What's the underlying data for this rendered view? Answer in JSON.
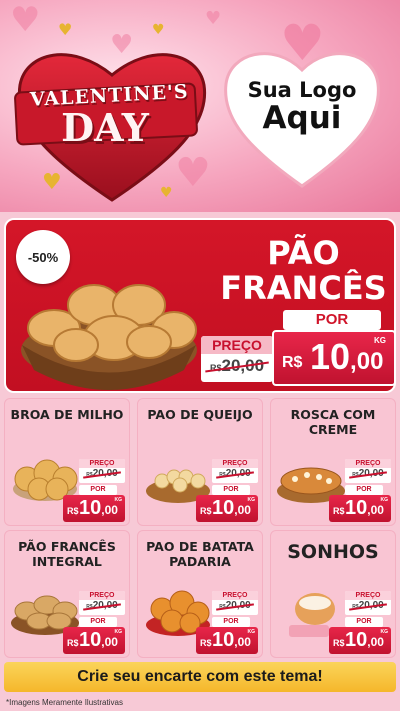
{
  "header": {
    "badge_line1": "VALENTINE'S",
    "badge_line2": "DAY",
    "logo_line1": "Sua Logo",
    "logo_line2": "Aqui"
  },
  "featured": {
    "discount": "-50%",
    "title_line1": "PÃO",
    "title_line2": "FRANCÊS",
    "por_label": "POR",
    "preco_label": "PREÇO",
    "old_currency": "R$",
    "old_price": "20,00",
    "currency": "R$",
    "price_int": "10",
    "price_cents": ",00",
    "unit": "KG"
  },
  "products": [
    {
      "name": "BROA DE MILHO",
      "preco_label": "PREÇO",
      "old_currency": "R$",
      "old_price": "20,00",
      "por_label": "POR",
      "currency": "R$",
      "price_int": "10",
      "price_cents": ",00",
      "unit": "KG"
    },
    {
      "name": "PAO DE QUEIJO",
      "preco_label": "PREÇO",
      "old_currency": "R$",
      "old_price": "20,00",
      "por_label": "POR",
      "currency": "R$",
      "price_int": "10",
      "price_cents": ",00",
      "unit": "KG"
    },
    {
      "name": "ROSCA COM CREME",
      "preco_label": "PREÇO",
      "old_currency": "R$",
      "old_price": "20,00",
      "por_label": "POR",
      "currency": "R$",
      "price_int": "10",
      "price_cents": ",00",
      "unit": "KG"
    },
    {
      "name": "PÃO FRANCÊS INTEGRAL",
      "preco_label": "PREÇO",
      "old_currency": "R$",
      "old_price": "20,00",
      "por_label": "POR",
      "currency": "R$",
      "price_int": "10",
      "price_cents": ",00",
      "unit": "KG"
    },
    {
      "name": "PAO DE BATATA PADARIA",
      "preco_label": "PREÇO",
      "old_currency": "R$",
      "old_price": "20,00",
      "por_label": "POR",
      "currency": "R$",
      "price_int": "10",
      "price_cents": ",00",
      "unit": "KG"
    },
    {
      "name": "SONHOS",
      "preco_label": "PREÇO",
      "old_currency": "R$",
      "old_price": "20,00",
      "por_label": "POR",
      "currency": "R$",
      "price_int": "10",
      "price_cents": ",00",
      "unit": "KG"
    }
  ],
  "cta": "Crie seu encarte com este tema!",
  "footnote": "*Imagens Meramente Ilustrativas",
  "colors": {
    "primary_red": "#c8102e",
    "pink_bg": "#f7c9d6",
    "cta_yellow": "#f5b72b"
  }
}
